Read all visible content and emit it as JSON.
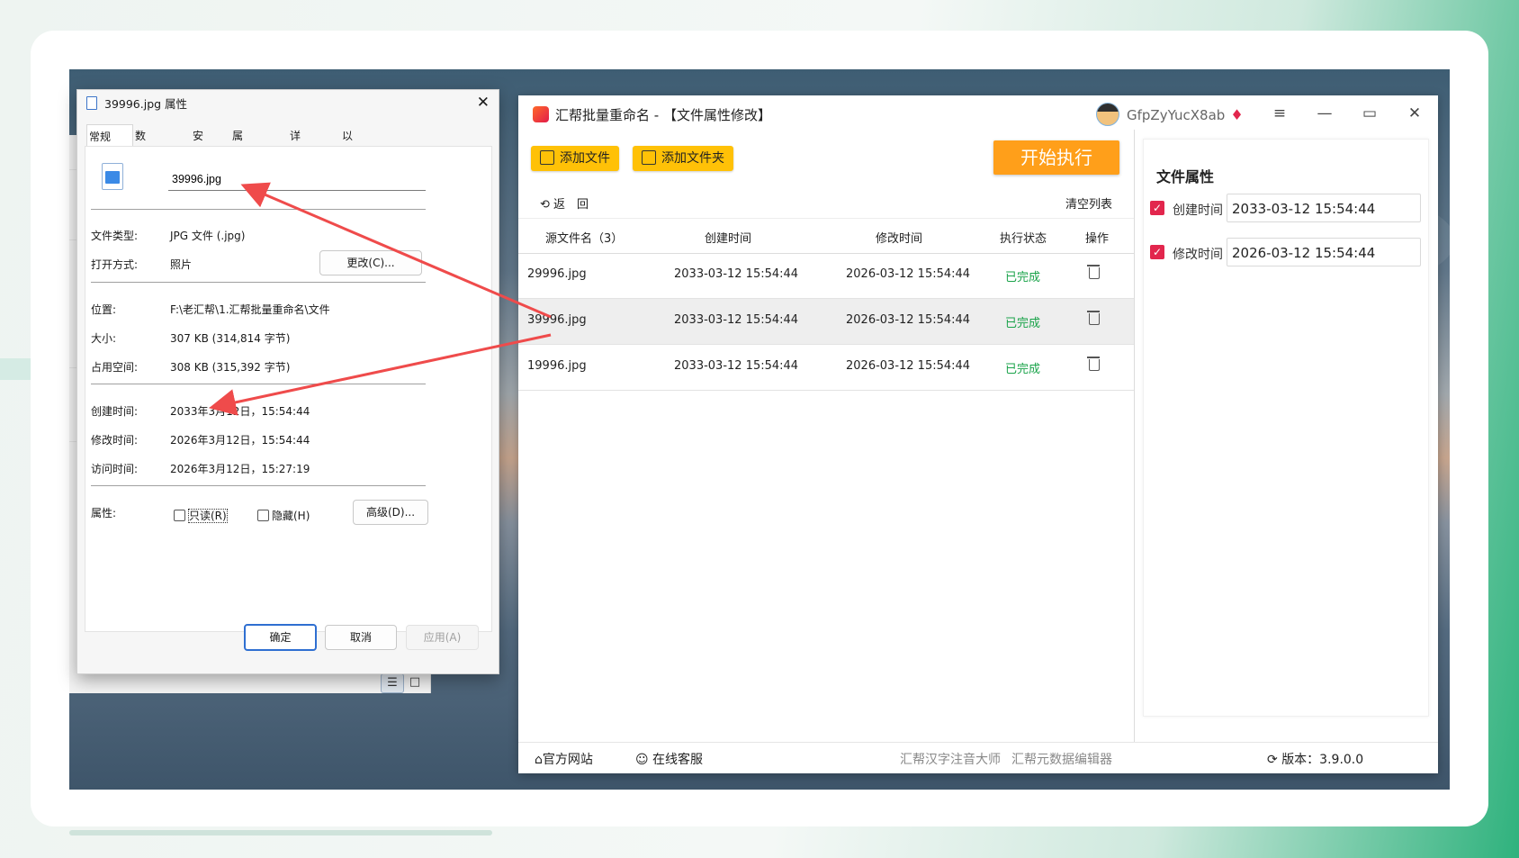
{
  "dialog": {
    "title": "39996.jpg 属性",
    "tabs": [
      "常规",
      "数字签名",
      "安全",
      "属性修改",
      "详细信息",
      "以前的版本"
    ],
    "filename": "39996.jpg",
    "rows1": [
      {
        "label": "文件类型:",
        "value": "JPG 文件 (.jpg)"
      },
      {
        "label": "打开方式:",
        "value": "照片"
      }
    ],
    "change_button": "更改(C)...",
    "rows2": [
      {
        "label": "位置:",
        "value": "F:\\老汇帮\\1.汇帮批量重命名\\文件"
      },
      {
        "label": "大小:",
        "value": "307 KB (314,814 字节)"
      },
      {
        "label": "占用空间:",
        "value": "308 KB (315,392 字节)"
      }
    ],
    "rows3": [
      {
        "label": "创建时间:",
        "value": "2033年3月12日，15:54:44"
      },
      {
        "label": "修改时间:",
        "value": "2026年3月12日，15:54:44"
      },
      {
        "label": "访问时间:",
        "value": "2026年3月12日，15:27:19"
      }
    ],
    "attr_label": "属性:",
    "readonly_label": "只读(R)",
    "hidden_label": "隐藏(H)",
    "advanced_button": "高级(D)...",
    "ok": "确定",
    "cancel": "取消",
    "apply": "应用(A)"
  },
  "app": {
    "title": "汇帮批量重命名 - 【文件属性修改】",
    "username": "GfpZyYucX8ab",
    "add_file": "添加文件",
    "add_folder": "添加文件夹",
    "start": "开始执行",
    "back": "返　回",
    "clear_list": "清空列表",
    "columns": [
      "源文件名（3）",
      "创建时间",
      "修改时间",
      "执行状态",
      "操作"
    ],
    "rows": [
      {
        "name": "29996.jpg",
        "created": "2033-03-12 15:54:44",
        "modified": "2026-03-12 15:54:44",
        "status": "已完成"
      },
      {
        "name": "39996.jpg",
        "created": "2033-03-12 15:54:44",
        "modified": "2026-03-12 15:54:44",
        "status": "已完成"
      },
      {
        "name": "19996.jpg",
        "created": "2033-03-12 15:54:44",
        "modified": "2026-03-12 15:54:44",
        "status": "已完成"
      }
    ],
    "side": {
      "heading": "文件属性",
      "created_label": "创建时间",
      "created_value": "2033-03-12 15:54:44",
      "modified_label": "修改时间",
      "modified_value": "2026-03-12 15:54:44"
    },
    "footer": {
      "website": "官方网站",
      "support": "在线客服",
      "link1": "汇帮汉字注音大师",
      "link2": "汇帮元数据编辑器",
      "version": "版本：3.9.0.0"
    }
  },
  "colors": {
    "accent": "#ffc107",
    "start": "#ff9f1a",
    "checkbox": "#e2264d",
    "done": "#1aa34a",
    "arrow": "#ef4b4b"
  }
}
